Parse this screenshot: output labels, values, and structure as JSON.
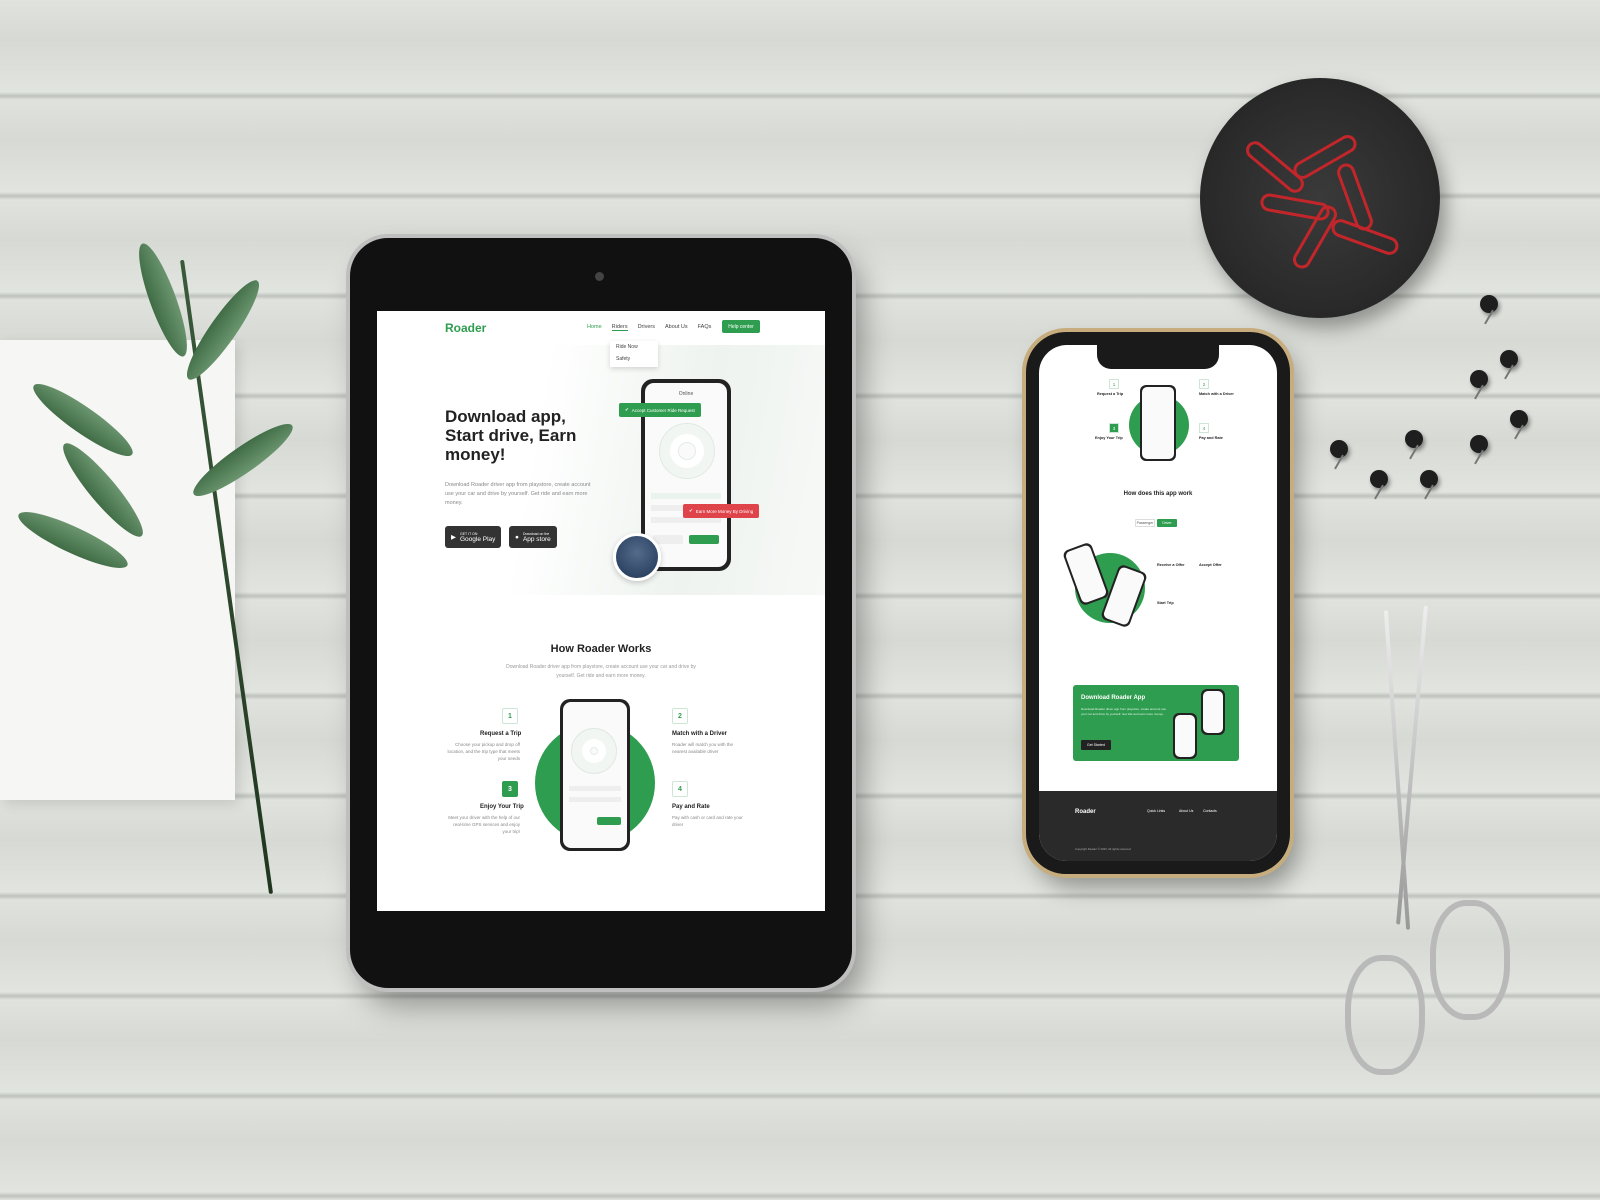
{
  "site": {
    "logo": "Roader",
    "nav": [
      "Home",
      "Riders",
      "Drivers",
      "About Us",
      "FAQs"
    ],
    "help_button": "Help center",
    "dropdown": [
      "Ride Now",
      "Safety"
    ]
  },
  "hero": {
    "title": "Download app, Start drive, Earn money!",
    "text": "Download Roader driver app from playstore, create account use your car and drive by yourself. Get ride and earn more money.",
    "google_play": {
      "small": "GET IT ON",
      "label": "Google Play"
    },
    "app_store": {
      "small": "Download on the",
      "label": "App store"
    },
    "phone_status": "Online",
    "toast_accept": "Accept Customer Ride Request",
    "toast_earn": "Earn More Money By Driving"
  },
  "works": {
    "title": "How Roader Works",
    "text": "Download Roader driver app from playstore, create account use your car and drive by yourself. Get ride and earn more money.",
    "steps": [
      {
        "num": "1",
        "title": "Request a Trip",
        "text": "Choose your pickup and drop off location, and the trip type that meets your needs"
      },
      {
        "num": "2",
        "title": "Match with a Driver",
        "text": "Roader will match you with the nearest available driver"
      },
      {
        "num": "3",
        "title": "Enjoy Your Trip",
        "text": "Meet your driver with the help of our real-time GPS services and enjoy your trip!"
      },
      {
        "num": "4",
        "title": "Pay and Rate",
        "text": "Pay with cash or card and rate your driver"
      }
    ]
  },
  "mobile": {
    "how_title": "How does this app work",
    "toggle": [
      "Passenger",
      "Driver"
    ],
    "features": [
      "Receive a Offer",
      "Accept Offer",
      "Start Trip"
    ],
    "cta_title": "Download Roader App",
    "cta_button": "Get Started",
    "footer_logo": "Roader",
    "footer_cols": [
      "Quick Links",
      "About Us",
      "Contacts"
    ],
    "copyright": "Copyright Roader © 2020. All rights reserved."
  },
  "colors": {
    "brand": "#2f9d4f",
    "danger": "#e0444b"
  }
}
